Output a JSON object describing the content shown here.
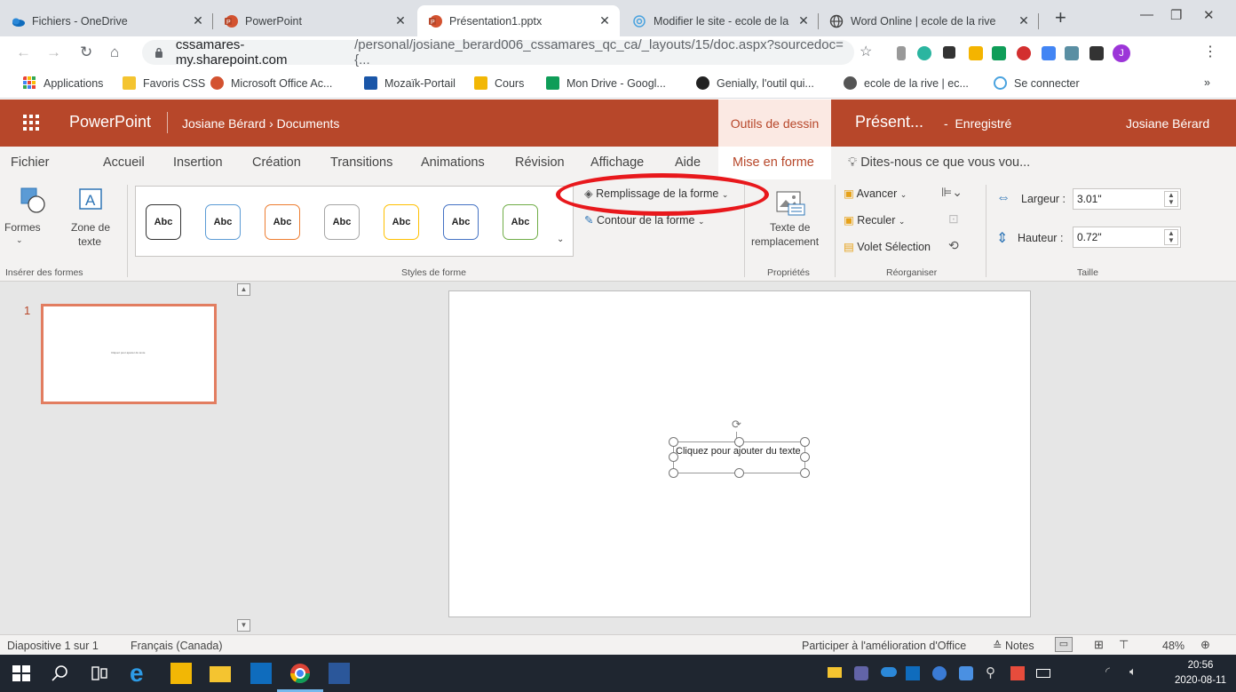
{
  "browser": {
    "tabs": [
      {
        "title": "Fichiers - OneDrive",
        "icon": "onedrive-icon"
      },
      {
        "title": "PowerPoint",
        "icon": "powerpoint-icon"
      },
      {
        "title": "Présentation1.pptx",
        "icon": "powerpoint-icon"
      },
      {
        "title": "Modifier le site - ecole de la",
        "icon": "sites-icon"
      },
      {
        "title": "Word Online | ecole de la rive",
        "icon": "globe-icon"
      }
    ],
    "url_main": "cssamares-my.sharepoint.com",
    "url_rest": "/personal/josiane_berard006_cssamares_qc_ca/_layouts/15/doc.aspx?sourcedoc={...",
    "profile_initial": "J",
    "bookmarks": [
      "Applications",
      "Favoris CSS",
      "Microsoft Office Ac...",
      "Mozaïk-Portail",
      "Cours",
      "Mon Drive - Googl...",
      "Genially, l'outil qui...",
      "ecole de la rive | ec...",
      "Se connecter"
    ],
    "bookmarks_more": "»"
  },
  "office": {
    "app_name": "PowerPoint",
    "breadcrumb_user": "Josiane Bérard",
    "breadcrumb_sep": "›",
    "breadcrumb_folder": "Documents",
    "contextual_tab": "Outils de dessin",
    "doc_name": "Présent...",
    "doc_dash": "-",
    "save_state": "Enregistré",
    "user_name": "Josiane Bérard"
  },
  "ribbon_tabs": [
    "Fichier",
    "Accueil",
    "Insertion",
    "Création",
    "Transitions",
    "Animations",
    "Révision",
    "Affichage",
    "Aide",
    "Mise en forme"
  ],
  "tell_me": "Dites-nous ce que vous vou...",
  "ribbon": {
    "formes": "Formes",
    "zone_de": "Zone de",
    "texte": "texte",
    "group_insert": "Insérer des formes",
    "style_label": "Abc",
    "group_styles": "Styles de forme",
    "fill": "Remplissage de la forme",
    "outline": "Contour de la forme",
    "alt_text_1": "Texte de",
    "alt_text_2": "remplacement",
    "group_props": "Propriétés",
    "forward": "Avancer",
    "backward": "Reculer",
    "selection_pane": "Volet Sélection",
    "group_arrange": "Réorganiser",
    "width_label": "Largeur :",
    "width_value": "3.01\"",
    "height_label": "Hauteur :",
    "height_value": "0.72\"",
    "group_size": "Taille"
  },
  "slides": {
    "thumb_number": "1",
    "thumb_text": "Cliquez pour ajouter du texte",
    "textbox_text": "Cliquez pour ajouter du texte"
  },
  "status": {
    "slide_count": "Diapositive 1 sur 1",
    "language": "Français (Canada)",
    "improve": "Participer à l'amélioration d'Office",
    "notes": "Notes",
    "zoom": "48%"
  },
  "taskbar": {
    "time": "20:56",
    "date": "2020-08-11"
  },
  "colors": {
    "office_accent": "#b7472a",
    "annotation": "#e8181c",
    "taskbar": "#1f2630"
  }
}
